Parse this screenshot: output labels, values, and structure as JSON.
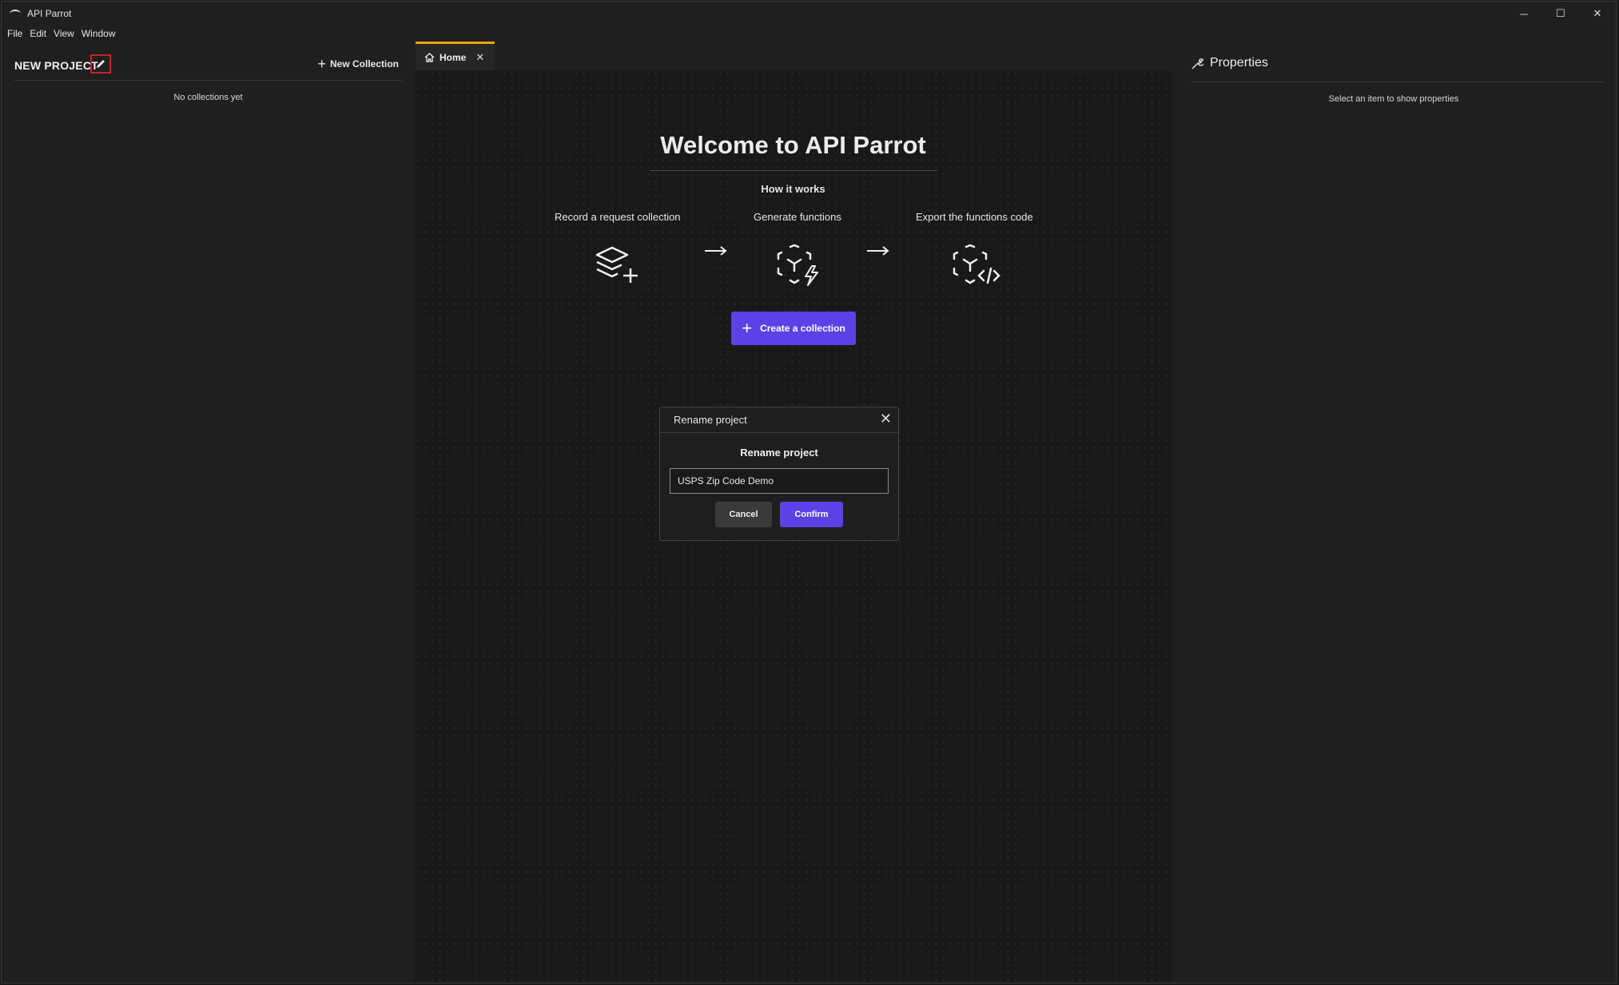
{
  "app": {
    "title": "API Parrot"
  },
  "window_controls": {
    "minimize": "─",
    "maximize": "☐",
    "close": "✕"
  },
  "menu": [
    "File",
    "Edit",
    "View",
    "Window"
  ],
  "left_panel": {
    "project_name": "NEW PROJECT",
    "new_collection_label": "New Collection",
    "empty_message": "No collections yet"
  },
  "tabs": [
    {
      "label": "Home",
      "icon": "home-icon"
    }
  ],
  "home": {
    "welcome_title": "Welcome to API Parrot",
    "how_it_works": "How it works",
    "steps": [
      {
        "label": "Record a request collection",
        "icon": "layers-plus-icon"
      },
      {
        "label": "Generate functions",
        "icon": "cube-bolt-icon"
      },
      {
        "label": "Export the functions code",
        "icon": "cube-code-icon"
      }
    ],
    "create_button": "Create a collection"
  },
  "dialog": {
    "title": "Rename project",
    "heading": "Rename project",
    "input_value": "USPS Zip Code Demo",
    "cancel": "Cancel",
    "confirm": "Confirm"
  },
  "properties": {
    "title": "Properties",
    "empty_message": "Select an item to show properties"
  },
  "colors": {
    "accent": "#5b41e6",
    "tab_indicator": "#e8a500",
    "highlight_border": "#d21f1f"
  }
}
